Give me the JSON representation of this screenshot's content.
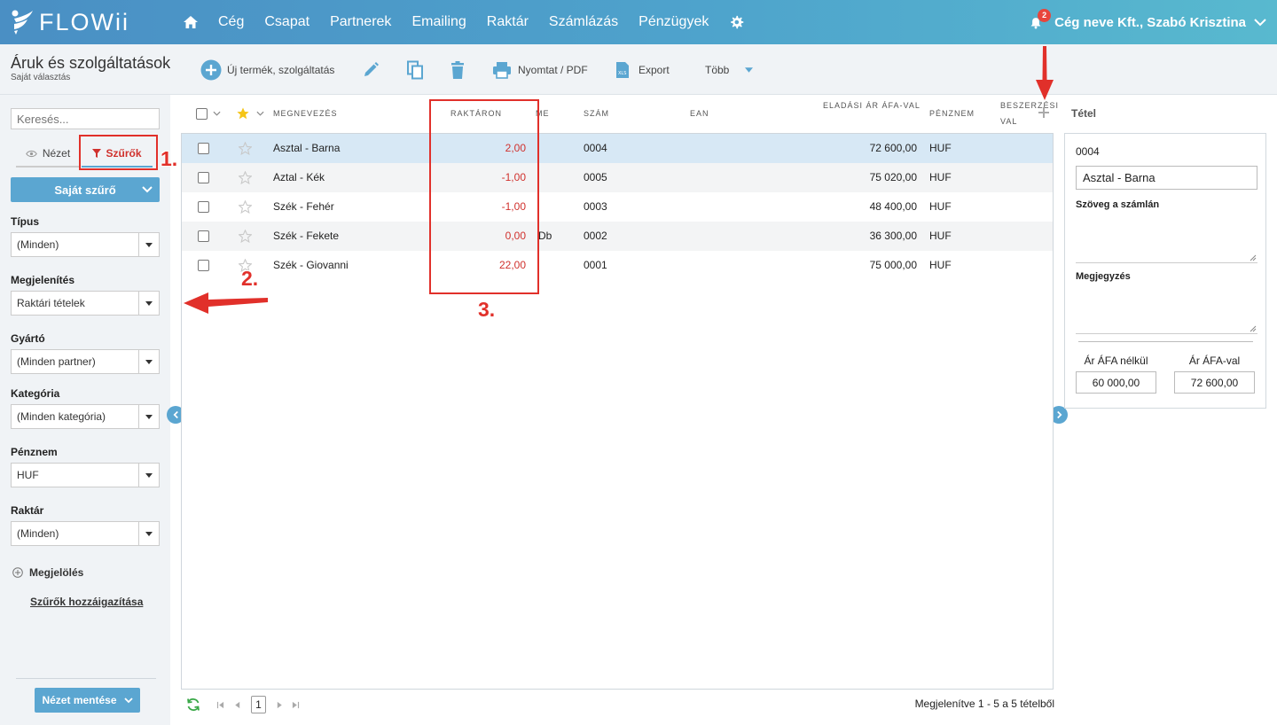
{
  "app": {
    "logo_text": "FLOWii"
  },
  "nav": {
    "items": [
      "Cég",
      "Csapat",
      "Partnerek",
      "Emailing",
      "Raktár",
      "Számlázás",
      "Pénzügyek"
    ],
    "notifications": "2",
    "user": "Cég neve Kft., Szabó Krisztina"
  },
  "page": {
    "title": "Áruk és szolgáltatások",
    "subtitle": "Saját választás"
  },
  "toolbar": {
    "new_label": "Új termék, szolgáltatás",
    "print_label": "Nyomtat / PDF",
    "export_label": "Export",
    "more_label": "Több"
  },
  "sidebar": {
    "search_placeholder": "Keresés...",
    "view_tab": "Nézet",
    "filter_tab": "Szűrők",
    "own_filter": "Saját szűrő",
    "filters": [
      {
        "label": "Típus",
        "value": "(Minden)"
      },
      {
        "label": "Megjelenítés",
        "value": "Raktári tételek"
      },
      {
        "label": "Gyártó",
        "value": "(Minden partner)"
      },
      {
        "label": "Kategória",
        "value": "(Minden kategória)"
      },
      {
        "label": "Pénznem",
        "value": "HUF"
      },
      {
        "label": "Raktár",
        "value": "(Minden)"
      }
    ],
    "mark_label": "Megjelölés",
    "assign_filters": "Szűrők hozzáigazítása",
    "save_view": "Nézet mentése"
  },
  "grid": {
    "headers": {
      "name": "MEGNEVEZÉS",
      "stock": "RAKTÁRON",
      "unit": "ME",
      "number": "SZÁM",
      "ean": "EAN",
      "price": "ELADÁSI ÁR ÁFA-VAL",
      "currency": "PÉNZNEM",
      "purchase": "BESZERZÉSI",
      "purchase2": "VAL"
    },
    "rows": [
      {
        "name": "Asztal - Barna",
        "stock": "2,00",
        "unit": "",
        "number": "0004",
        "price": "72 600,00",
        "currency": "HUF"
      },
      {
        "name": "Aztal - Kék",
        "stock": "-1,00",
        "unit": "",
        "number": "0005",
        "price": "75 020,00",
        "currency": "HUF"
      },
      {
        "name": "Szék - Fehér",
        "stock": "-1,00",
        "unit": "",
        "number": "0003",
        "price": "48 400,00",
        "currency": "HUF"
      },
      {
        "name": "Szék - Fekete",
        "stock": "0,00",
        "unit": "Db",
        "number": "0002",
        "price": "36 300,00",
        "currency": "HUF"
      },
      {
        "name": "Szék - Giovanni",
        "stock": "22,00",
        "unit": "",
        "number": "0001",
        "price": "75 000,00",
        "currency": "HUF"
      }
    ],
    "page_current": "1",
    "footer_info": "Megjelenítve 1 - 5 a 5 tételből"
  },
  "detail": {
    "tab": "Tétel",
    "number": "0004",
    "name": "Asztal - Barna",
    "invoice_text_label": "Szöveg a számlán",
    "note_label": "Megjegyzés",
    "net_label": "Ár ÁFA nélkül",
    "gross_label": "Ár ÁFA-val",
    "net_value": "60 000,00",
    "gross_value": "72 600,00"
  },
  "annotations": {
    "a1": "1.",
    "a2": "2.",
    "a3": "3."
  },
  "colors": {
    "brand": "#4ea3cc",
    "accent_blue": "#5ba6d1",
    "negative": "#d0312d",
    "annotation": "#e1302a"
  }
}
